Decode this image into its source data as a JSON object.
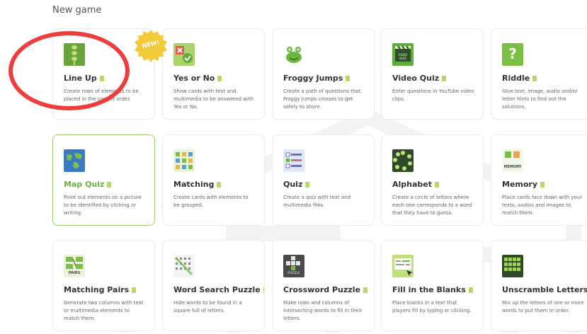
{
  "heading": "New game",
  "new_badge": "NEW!",
  "cards": [
    {
      "title": "Line Up",
      "desc": "Create rows of elements to be placed in the correct order.",
      "icon": "line-up-icon"
    },
    {
      "title": "Yes or No",
      "desc": "Show cards with text and multimedia to be answered with Yes or No.",
      "icon": "yes-no-icon"
    },
    {
      "title": "Froggy Jumps",
      "desc": "Create a path of questions that Froggy Jumps crosses to get safely to shore.",
      "icon": "frog-icon"
    },
    {
      "title": "Video Quiz",
      "desc": "Enter questions in YouTube video clips.",
      "icon": "clapperboard-icon",
      "icon_text": "VIDEO QUIZ"
    },
    {
      "title": "Riddle",
      "desc": "Give text, image, audio and/or letter hints to find out the solutions.",
      "icon": "question-mark-icon",
      "icon_text": "?"
    },
    {
      "title": "Map Quiz",
      "desc": "Point out elements on a picture to be identified by clicking or writing.",
      "icon": "map-icon",
      "selected": true
    },
    {
      "title": "Matching",
      "desc": "Create cards with elements to be grouped.",
      "icon": "matching-grid-icon"
    },
    {
      "title": "Quiz",
      "desc": "Create a quiz with text and multimedia files.",
      "icon": "checklist-icon"
    },
    {
      "title": "Alphabet",
      "desc": "Create a circle of letters where each one corresponds to a word that they have to guess.",
      "icon": "alphabet-circle-icon"
    },
    {
      "title": "Memory",
      "desc": "Place cards face down with your texts, audios and images to match them.",
      "icon": "memory-icon",
      "icon_text": "MEMORY"
    },
    {
      "title": "Matching Pairs",
      "desc": "Generate two columns with text or multimedia elements to match them.",
      "icon": "pairs-icon",
      "icon_text": "PAIRS"
    },
    {
      "title": "Word Search Puzzle",
      "desc": "Hide words to be found in a square full of letters.",
      "icon": "word-search-icon"
    },
    {
      "title": "Crossword Puzzle",
      "desc": "Make rows and columns of intersecting words to fill in their letters.",
      "icon": "crossword-icon",
      "icon_text": "PUZZLE"
    },
    {
      "title": "Fill in the Blanks",
      "desc": "Place blanks in a text that players fill by typing or clicking.",
      "icon": "fill-blanks-icon"
    },
    {
      "title": "Unscramble Letters",
      "desc": "Mix up the letters of one or more words to put them in order.",
      "icon": "unscramble-icon"
    }
  ]
}
